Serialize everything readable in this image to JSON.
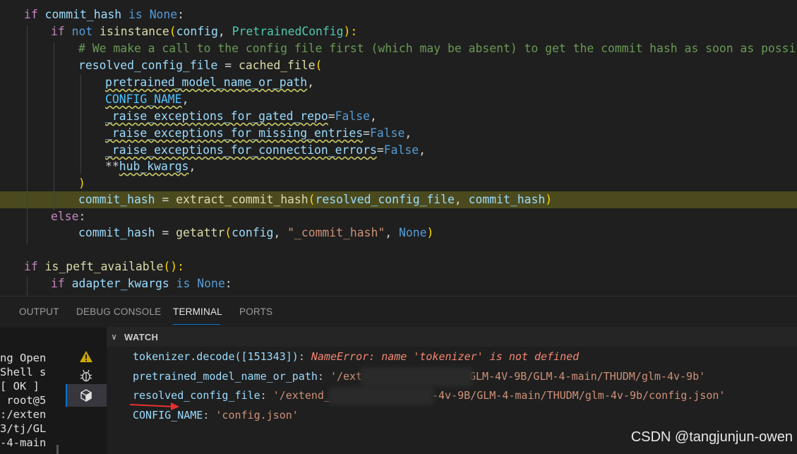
{
  "code": {
    "l1": [
      "if",
      " ",
      "commit_hash",
      " ",
      "is",
      " ",
      "None",
      ":"
    ],
    "l2": [
      "if",
      " ",
      "not",
      " ",
      "isinstance",
      "(",
      "config",
      ", ",
      "PretrainedConfig",
      "):"
    ],
    "l3": "# We make a call to the config file first (which may be absent) to get the commit hash as soon as possible",
    "l4": [
      "resolved_config_file",
      " = ",
      "cached_file",
      "("
    ],
    "l5": [
      "pretrained_model_name_or_path",
      ","
    ],
    "l6": [
      "CONFIG_NAME",
      ","
    ],
    "l7": [
      "_raise_exceptions_for_gated_repo",
      "=",
      "False",
      ","
    ],
    "l8": [
      "_raise_exceptions_for_missing_entries",
      "=",
      "False",
      ","
    ],
    "l9": [
      "_raise_exceptions_for_connection_errors",
      "=",
      "False",
      ","
    ],
    "l10": [
      "**",
      "hub_kwargs",
      ","
    ],
    "l11": ")",
    "l12": [
      "commit_hash",
      " = ",
      "extract_commit_hash",
      "(",
      "resolved_config_file",
      ", ",
      "commit_hash",
      ")"
    ],
    "l13": [
      "else",
      ":"
    ],
    "l14": [
      "commit_hash",
      " = ",
      "getattr",
      "(",
      "config",
      ", ",
      "\"_commit_hash\"",
      ", ",
      "None",
      ")"
    ],
    "l16": [
      "if",
      " ",
      "is_peft_available",
      "():"
    ],
    "l17": [
      "if",
      " ",
      "adapter_kwargs",
      " ",
      "is",
      " ",
      "None",
      ":"
    ]
  },
  "panel": {
    "tabs": [
      "OUTPUT",
      "DEBUG CONSOLE",
      "TERMINAL",
      "PORTS"
    ],
    "active_tab": "TERMINAL"
  },
  "terminal_lines": [
    "ng Open",
    "Shell s",
    "[ OK ]",
    " root@5",
    ":/exten",
    "3/tj/GL",
    "-4-main"
  ],
  "watch": {
    "title": "WATCH",
    "items": [
      {
        "expr": "tokenizer.decode([151343])",
        "sep": ": ",
        "value": "NameError: name 'tokenizer' is not defined",
        "kind": "error"
      },
      {
        "expr": "pretrained_model_name_or_path",
        "sep": ": ",
        "value_pre": "'/ext",
        "value": "GLM-4V-9B/GLM-4-main/THUDM/glm-4v-9b'",
        "kind": "string"
      },
      {
        "expr": "resolved_config_file",
        "sep": ": ",
        "value_pre": "'/extend_",
        "value": "-4v-9B/GLM-4-main/THUDM/glm-4v-9b/config.json'",
        "kind": "string"
      },
      {
        "expr": "CONFIG_NAME",
        "sep": ": ",
        "value": "'config.json'",
        "kind": "string"
      }
    ]
  },
  "icons": [
    "warning-icon",
    "debug-bug-icon",
    "package-icon"
  ],
  "watermark": "CSDN @tangjunjun-owen",
  "colors": {
    "highlight": "#4b4a1e",
    "accent": "#0078d4",
    "arrow": "#e8312f"
  }
}
